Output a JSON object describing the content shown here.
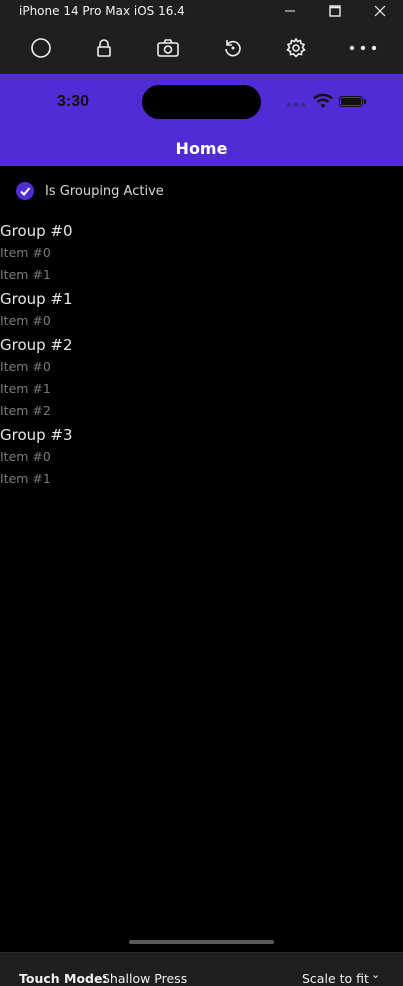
{
  "window": {
    "title": "iPhone 14 Pro Max iOS 16.4",
    "controls": [
      "minimize-icon",
      "maximize-icon",
      "close-icon"
    ]
  },
  "toolbar": {
    "buttons": [
      "home-icon",
      "lock-icon",
      "screenshot-icon",
      "rotate-icon",
      "settings-icon",
      "more-icon"
    ]
  },
  "device": {
    "status": {
      "time": "3:30"
    },
    "nav_title": "Home"
  },
  "grouping": {
    "checkbox_label": "Is Grouping Active",
    "checked": true
  },
  "groups": [
    {
      "title": "Group #0",
      "items": [
        "Item #0",
        "Item #1"
      ]
    },
    {
      "title": "Group #1",
      "items": [
        "Item #0"
      ]
    },
    {
      "title": "Group #2",
      "items": [
        "Item #0",
        "Item #1",
        "Item #2"
      ]
    },
    {
      "title": "Group #3",
      "items": [
        "Item #0",
        "Item #1"
      ]
    }
  ],
  "footer": {
    "touch_mode_label": "Touch Mode:",
    "touch_mode_value": "Shallow Press",
    "scale_value": "Scale to fit"
  },
  "colors": {
    "accent": "#512bd4",
    "background": "#000000",
    "chrome": "#1f1f1f"
  }
}
